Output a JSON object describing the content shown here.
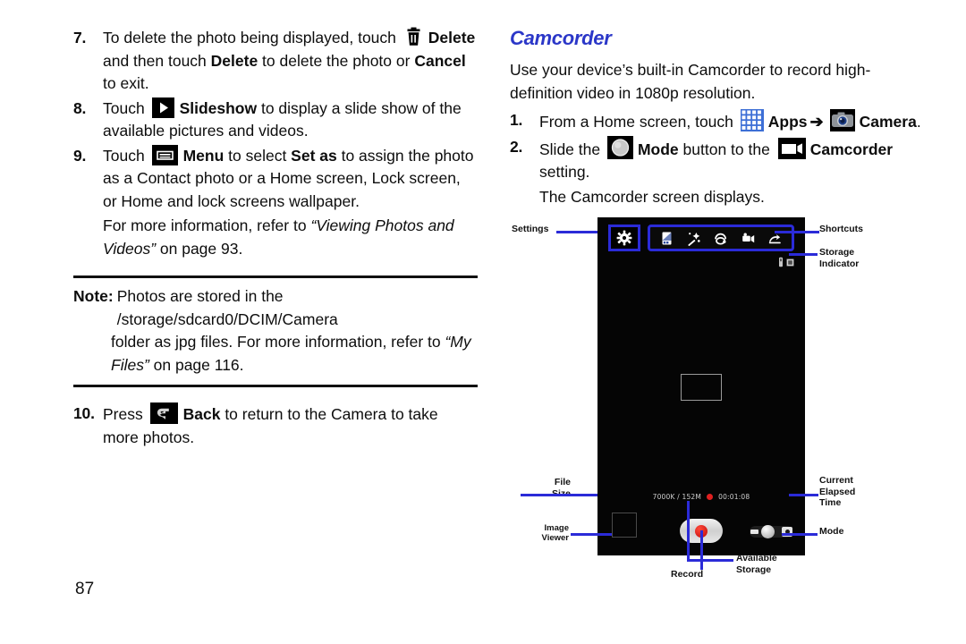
{
  "page": {
    "number": "87"
  },
  "left_column": {
    "steps": [
      {
        "number": "7.",
        "segments": [
          {
            "t": "To delete the photo being displayed, touch ",
            "style": "normal"
          },
          {
            "t": "delete-icon",
            "style": "icon"
          },
          {
            "t": "Delete",
            "style": "bold"
          },
          {
            "t": " and then touch ",
            "style": "normal"
          },
          {
            "t": "Delete",
            "style": "bold"
          },
          {
            "t": " to delete the photo or ",
            "style": "normal"
          },
          {
            "t": "Cancel",
            "style": "bold"
          },
          {
            "t": " to exit.",
            "style": "normal"
          }
        ]
      },
      {
        "number": "8.",
        "segments": [
          {
            "t": "Touch ",
            "style": "normal"
          },
          {
            "t": "slideshow-icon",
            "style": "icon"
          },
          {
            "t": "Slideshow",
            "style": "bold"
          },
          {
            "t": " to display a slide show of the available pictures and videos.",
            "style": "normal"
          }
        ]
      },
      {
        "number": "9.",
        "segments": [
          {
            "t": "Touch ",
            "style": "normal"
          },
          {
            "t": "menu-icon",
            "style": "icon"
          },
          {
            "t": "Menu",
            "style": "bold"
          },
          {
            "t": " to select ",
            "style": "normal"
          },
          {
            "t": "Set as",
            "style": "bold"
          },
          {
            "t": " to assign the photo as a Contact photo or a Home screen, Lock screen, or Home and lock screens wallpaper.",
            "style": "normal"
          }
        ]
      }
    ],
    "step9_note": {
      "lead": "For more information, refer to ",
      "italic": "“Viewing Photos and Videos”",
      "tail": " on page 93."
    },
    "note": {
      "label": "Note:",
      "line1": "Photos are stored in the /storage/sdcard0/DCIM/Camera",
      "line2_lead": "folder as jpg files. For more information, refer to ",
      "line2_italic": "“My Files”",
      "line2_tail": " on page 116."
    },
    "step10": {
      "number": "10.",
      "segments": [
        {
          "t": "Press ",
          "style": "normal"
        },
        {
          "t": "back-icon",
          "style": "icon"
        },
        {
          "t": "Back",
          "style": "bold"
        },
        {
          "t": " to return to the Camera to take more photos.",
          "style": "normal"
        }
      ]
    }
  },
  "right_column": {
    "heading": "Camcorder",
    "intro": "Use your device’s built-in Camcorder to record high-definition video in 1080p resolution.",
    "step1": {
      "number": "1.",
      "prefix": "From a Home screen, touch ",
      "apps_label": "Apps",
      "arrow": "➔",
      "camera_label": "Camera",
      "suffix": "."
    },
    "step2": {
      "number": "2.",
      "prefix": "Slide the ",
      "mode_label": "Mode",
      "middle": " button to the ",
      "camcorder_label": "Camcorder",
      "suffix": " setting."
    },
    "step2_result": "The Camcorder screen displays."
  },
  "figure": {
    "callouts": {
      "settings": "Settings",
      "shortcuts": "Shortcuts",
      "storage_indicator_line1": "Storage",
      "storage_indicator_line2": "Indicator",
      "file_size_line1": "File",
      "file_size_line2": "Size",
      "current_elapsed_line1": "Current",
      "current_elapsed_line2": "Elapsed",
      "current_elapsed_line3": "Time",
      "image_viewer_line1": "Image",
      "image_viewer_line2": "Viewer",
      "mode": "Mode",
      "record": "Record",
      "available_storage_line1": "Available",
      "available_storage_line2": "Storage"
    },
    "screen": {
      "file_size_value": "7000K / 152M",
      "elapsed_time_value": "00:01:08",
      "shortcut_icons": [
        "self-portrait-icon",
        "effects-wand-icon",
        "recording-mode-icon",
        "camcorder-mode-icon",
        "video-stabilize-icon"
      ],
      "settings_icon": "gear-icon",
      "storage_icons": [
        "sd-card-icon",
        "memory-icon"
      ],
      "record_button_icon": "record-button",
      "mode_switch_icon": "mode-switch",
      "image_viewer_icon": "image-viewer-thumbnail"
    }
  },
  "colors": {
    "heading_blue": "#2b37c8",
    "callout_blue": "#2b2bd8",
    "record_red": "#e02020",
    "screen_black": "#050505"
  }
}
